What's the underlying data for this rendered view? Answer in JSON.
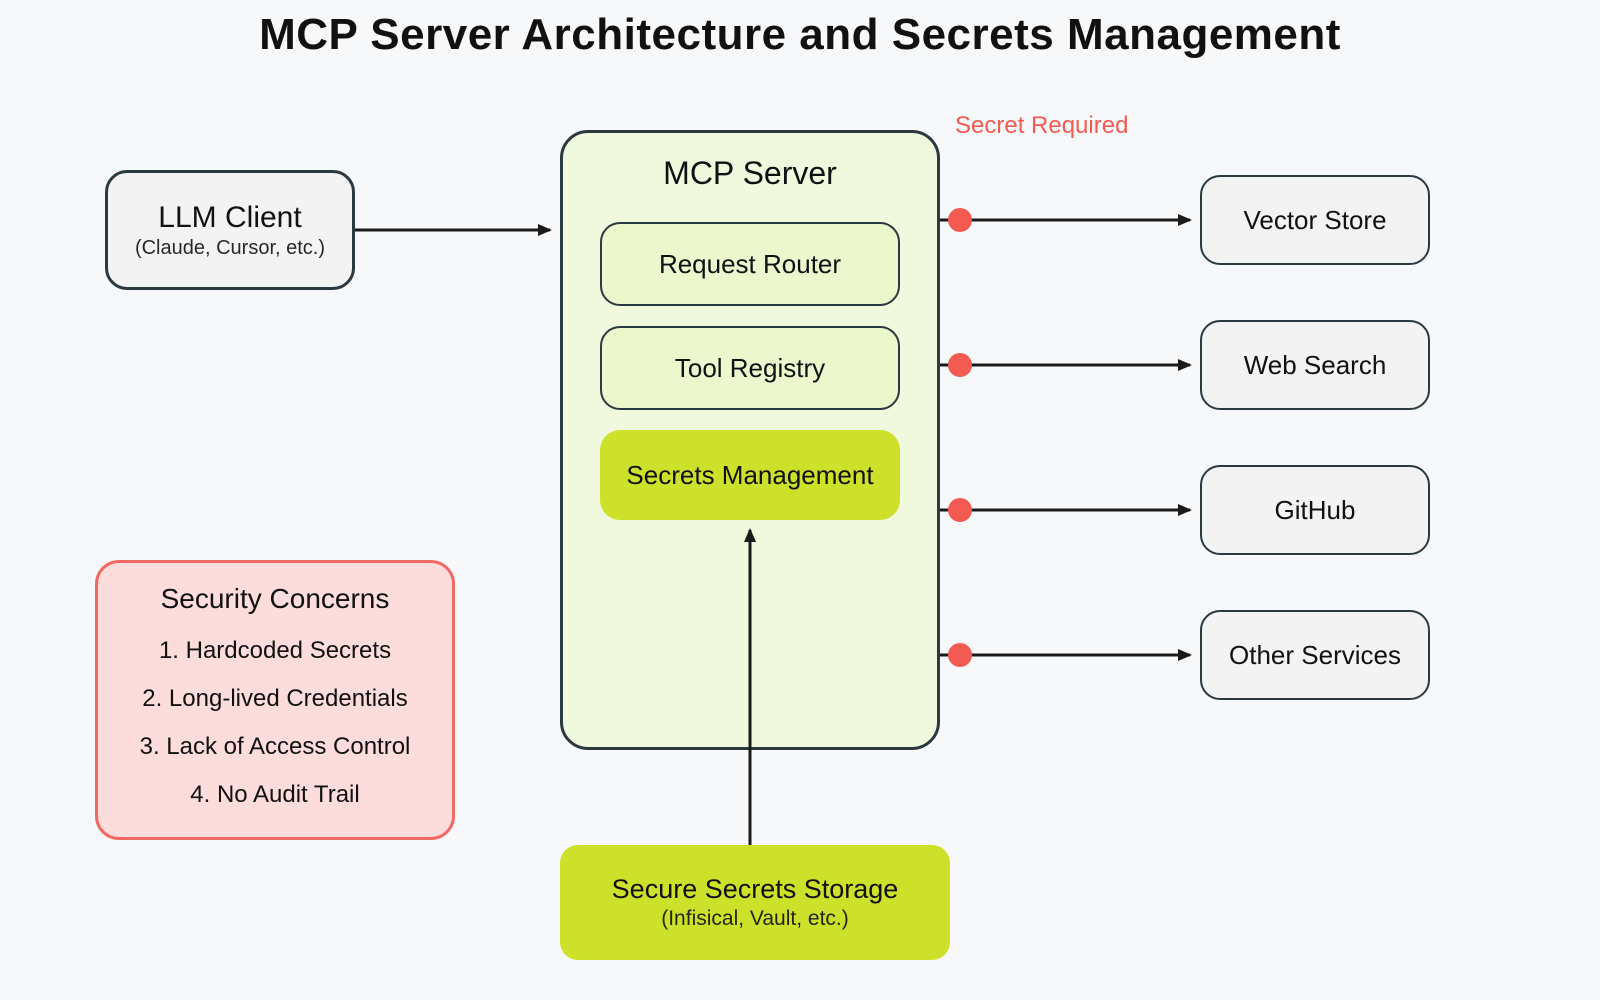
{
  "title": "MCP Server Architecture and Secrets Management",
  "llm_client": {
    "label": "LLM Client",
    "sub": "(Claude, Cursor, etc.)"
  },
  "mcp_server": {
    "title": "MCP Server",
    "components": {
      "router": "Request Router",
      "registry": "Tool Registry",
      "secrets": "Secrets Management"
    }
  },
  "external": {
    "vector_store": "Vector Store",
    "web_search": "Web Search",
    "github": "GitHub",
    "other": "Other Services"
  },
  "secrets_storage": {
    "label": "Secure Secrets Storage",
    "sub": "(Infisical, Vault, etc.)"
  },
  "secret_required_label": "Secret Required",
  "concerns": {
    "title": "Security Concerns",
    "items": [
      "1. Hardcoded Secrets",
      "2. Long-lived Credentials",
      "3. Lack of Access Control",
      "4. No Audit Trail"
    ]
  },
  "colors": {
    "accent_green_light": "#f0f9dd",
    "accent_green_mid": "#edf7ce",
    "accent_green_strong": "#cde02a",
    "warn_bg": "#fcdddc",
    "warn_border": "#f26a63",
    "dot_red": "#f25a52",
    "stroke": "#1a1a1a"
  }
}
